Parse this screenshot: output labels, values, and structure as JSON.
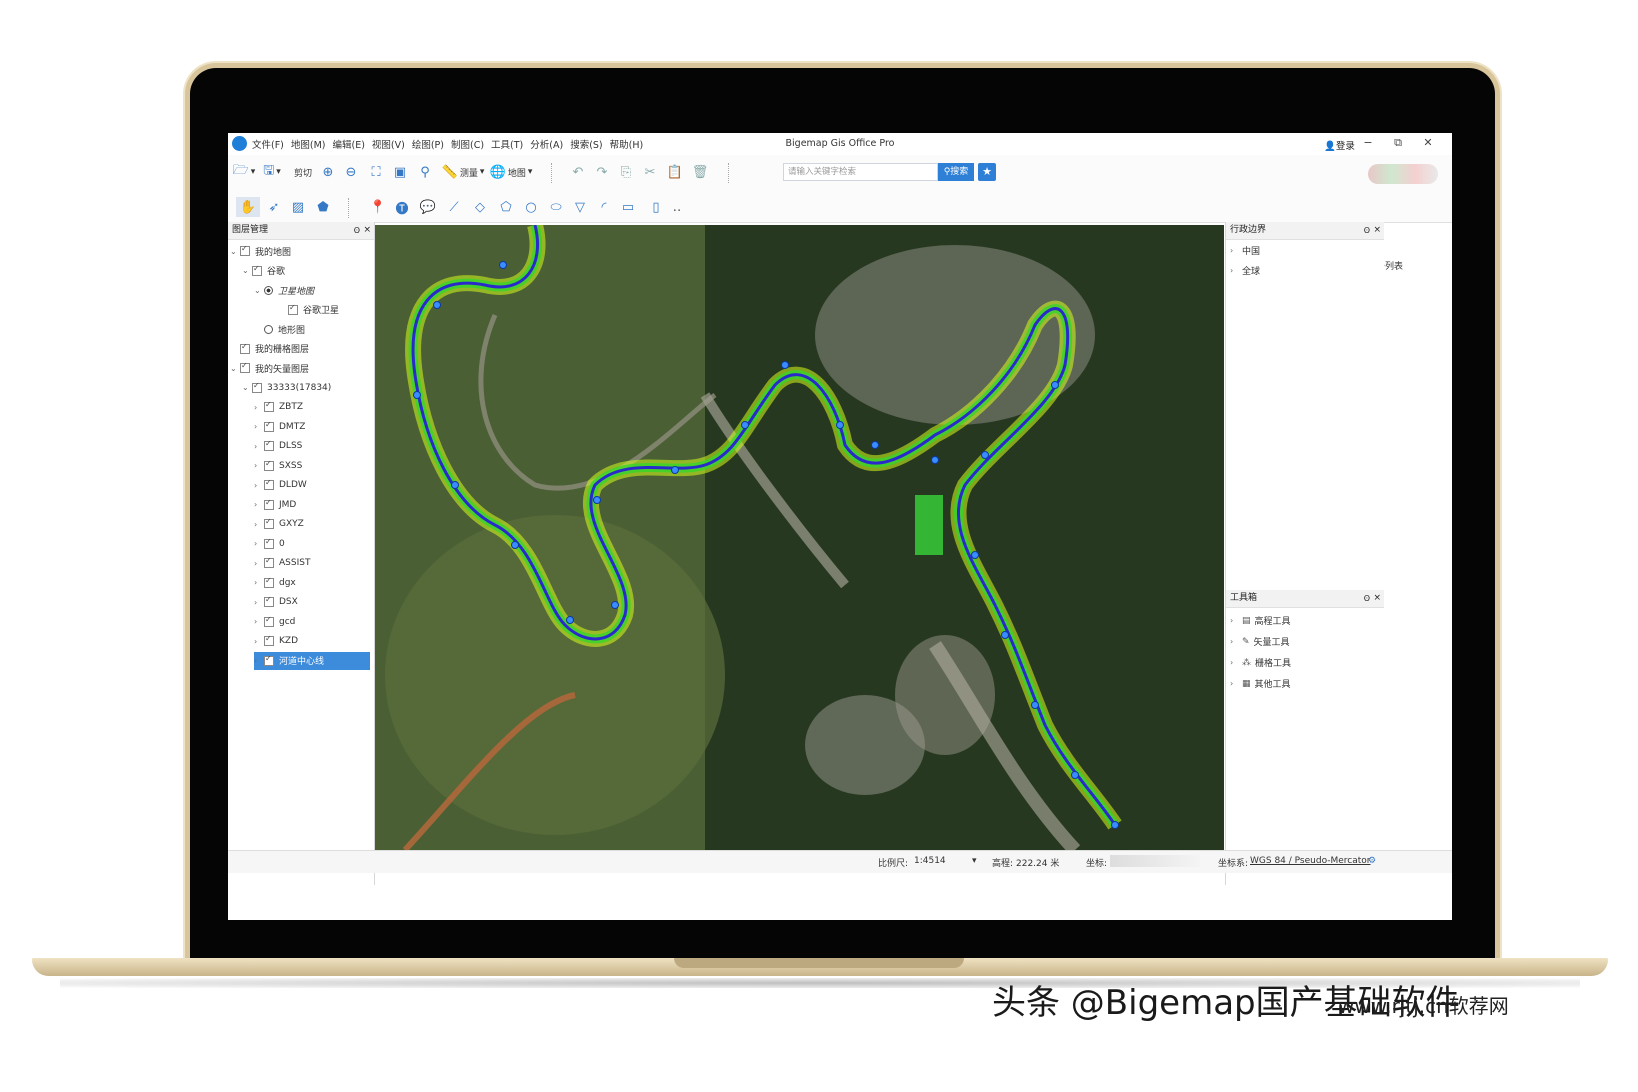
{
  "window": {
    "title": "Bigemap Gis Office Pro",
    "login": "登录",
    "minimize": "−",
    "maximize": "⧉",
    "close": "✕"
  },
  "menu": [
    "文件(F)",
    "地图(M)",
    "编辑(E)",
    "视图(V)",
    "绘图(P)",
    "制图(C)",
    "工具(T)",
    "分析(A)",
    "搜索(S)",
    "帮助(H)"
  ],
  "toolbar": {
    "open_label": "▾",
    "save_label": "▾",
    "clip_label": "剪切",
    "measure_label": "测量",
    "map_label": "地图",
    "search_placeholder": "请输入关键字检索",
    "search_button": "搜索",
    "task_list": "任务列表"
  },
  "layer_panel": {
    "title": "图层管理",
    "pin": "ʘ",
    "close": "×",
    "items": [
      {
        "label": "我的地图",
        "type": "check"
      },
      {
        "label": "谷歌",
        "type": "check"
      },
      {
        "label": "卫星地图",
        "type": "radio"
      },
      {
        "label": "谷歌卫星",
        "type": "check"
      },
      {
        "label": "地形图",
        "type": "radio"
      },
      {
        "label": "我的栅格图层",
        "type": "check"
      },
      {
        "label": "我的矢量图层",
        "type": "check"
      },
      {
        "label": "33333(17834)",
        "type": "check"
      },
      {
        "label": "ZBTZ",
        "type": "check"
      },
      {
        "label": "DMTZ",
        "type": "check"
      },
      {
        "label": "DLSS",
        "type": "check"
      },
      {
        "label": "SXSS",
        "type": "check"
      },
      {
        "label": "DLDW",
        "type": "check"
      },
      {
        "label": "JMD",
        "type": "check"
      },
      {
        "label": "GXYZ",
        "type": "check"
      },
      {
        "label": "0",
        "type": "check"
      },
      {
        "label": "ASSIST",
        "type": "check"
      },
      {
        "label": "dgx",
        "type": "check"
      },
      {
        "label": "DSX",
        "type": "check"
      },
      {
        "label": "gcd",
        "type": "check"
      },
      {
        "label": "KZD",
        "type": "check"
      },
      {
        "label": "河道中心线",
        "type": "check"
      }
    ]
  },
  "admin_panel": {
    "title": "行政边界",
    "items": [
      "中国",
      "全球"
    ]
  },
  "toolbox_panel": {
    "title": "工具箱",
    "items": [
      "高程工具",
      "矢量工具",
      "栅格工具",
      "其他工具"
    ]
  },
  "status": {
    "scale_label": "比例尺:",
    "scale_value": "1:4514",
    "elevation_label": "高程:",
    "elevation_value": "222.24 米",
    "coord_label": "坐标:",
    "crs_label": "坐标系:",
    "crs_value": "WGS 84 / Pseudo-Mercator"
  },
  "watermark": {
    "text": "头条 @Bigemap国产基础软件",
    "site": "www.rjtj.cn软荐网"
  }
}
